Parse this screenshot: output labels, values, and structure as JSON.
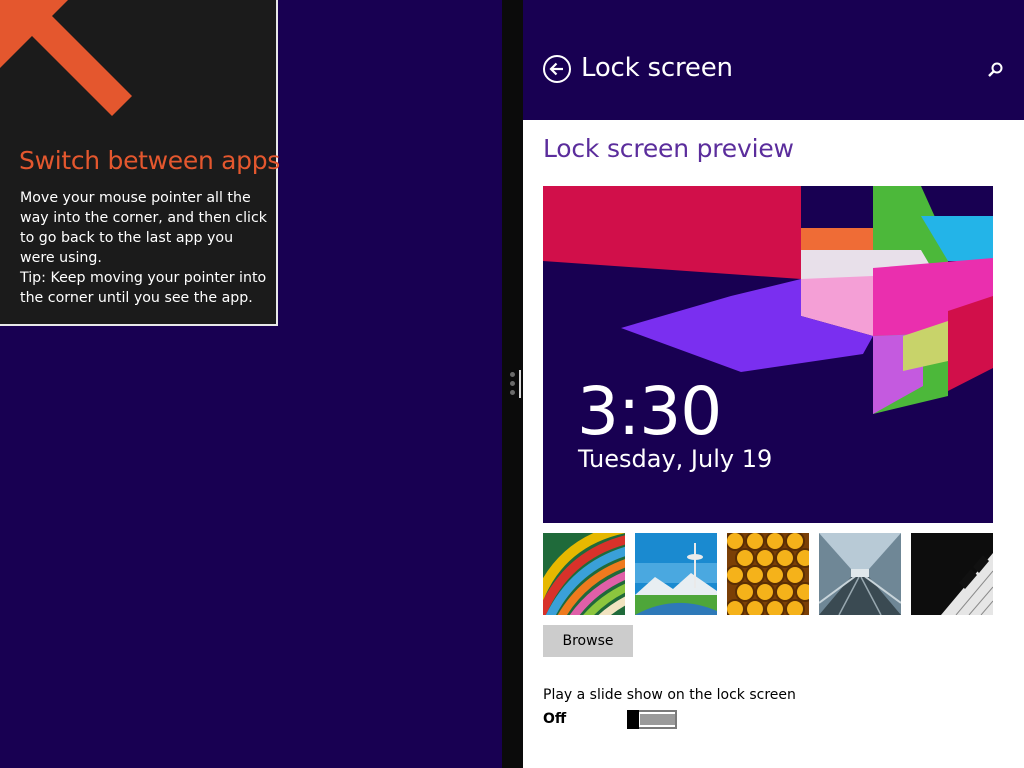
{
  "tip": {
    "title": "Switch between apps",
    "body": "Move your mouse pointer all the way into the corner, and then click to go back to the last app you were using.",
    "tip_text": "Tip: Keep moving your pointer into the corner until you see the app.",
    "arrow_color": "#e4572e"
  },
  "header": {
    "back_icon": "back-arrow-icon",
    "title": "Lock screen",
    "search_icon": "search-icon"
  },
  "preview": {
    "heading": "Lock screen preview",
    "time": "3:30",
    "date": "Tuesday, July 19"
  },
  "thumbnails": [
    {
      "name": "rainbow-ribbons"
    },
    {
      "name": "space-needle"
    },
    {
      "name": "honeycomb"
    },
    {
      "name": "train-station"
    },
    {
      "name": "piano-keys"
    }
  ],
  "browse_label": "Browse",
  "slideshow": {
    "label": "Play a slide show on the lock screen",
    "state": "Off",
    "enabled": false
  },
  "colors": {
    "accent_background": "#180052",
    "heading_purple": "#5b2d9c",
    "tip_orange": "#e4572e"
  }
}
